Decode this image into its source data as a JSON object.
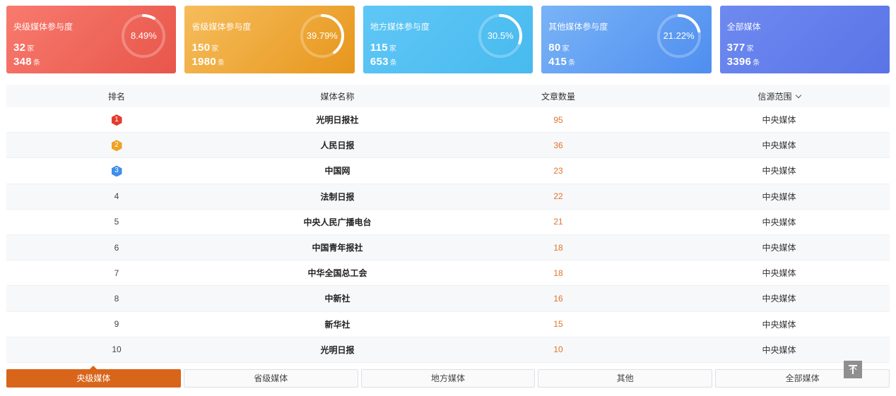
{
  "cards": [
    {
      "title": "央级媒体参与度",
      "percent_label": "8.49%",
      "percent": 8.49,
      "count1": "32",
      "unit1": "家",
      "count2": "348",
      "unit2": "条"
    },
    {
      "title": "省级媒体参与度",
      "percent_label": "39.79%",
      "percent": 39.79,
      "count1": "150",
      "unit1": "家",
      "count2": "1980",
      "unit2": "条"
    },
    {
      "title": "地方媒体参与度",
      "percent_label": "30.5%",
      "percent": 30.5,
      "count1": "115",
      "unit1": "家",
      "count2": "653",
      "unit2": "条"
    },
    {
      "title": "其他媒体参与度",
      "percent_label": "21.22%",
      "percent": 21.22,
      "count1": "80",
      "unit1": "家",
      "count2": "415",
      "unit2": "条"
    },
    {
      "title": "全部媒体",
      "count1": "377",
      "unit1": "家",
      "count2": "3396",
      "unit2": "条"
    }
  ],
  "table": {
    "headers": {
      "rank": "排名",
      "name": "媒体名称",
      "count": "文章数量",
      "scope": "信源范围"
    },
    "rows": [
      {
        "rank": "1",
        "name": "光明日报社",
        "count": "95",
        "scope": "中央媒体"
      },
      {
        "rank": "2",
        "name": "人民日报",
        "count": "36",
        "scope": "中央媒体"
      },
      {
        "rank": "3",
        "name": "中国网",
        "count": "23",
        "scope": "中央媒体"
      },
      {
        "rank": "4",
        "name": "法制日报",
        "count": "22",
        "scope": "中央媒体"
      },
      {
        "rank": "5",
        "name": "中央人民广播电台",
        "count": "21",
        "scope": "中央媒体"
      },
      {
        "rank": "6",
        "name": "中国青年报社",
        "count": "18",
        "scope": "中央媒体"
      },
      {
        "rank": "7",
        "name": "中华全国总工会",
        "count": "18",
        "scope": "中央媒体"
      },
      {
        "rank": "8",
        "name": "中新社",
        "count": "16",
        "scope": "中央媒体"
      },
      {
        "rank": "9",
        "name": "新华社",
        "count": "15",
        "scope": "中央媒体"
      },
      {
        "rank": "10",
        "name": "光明日报",
        "count": "10",
        "scope": "中央媒体"
      }
    ]
  },
  "tabs": [
    "央级媒体",
    "省级媒体",
    "地方媒体",
    "其他",
    "全部媒体"
  ],
  "active_tab": "央级媒体",
  "colors": {
    "accent": "#d9651a",
    "count_text": "#e0742a"
  }
}
